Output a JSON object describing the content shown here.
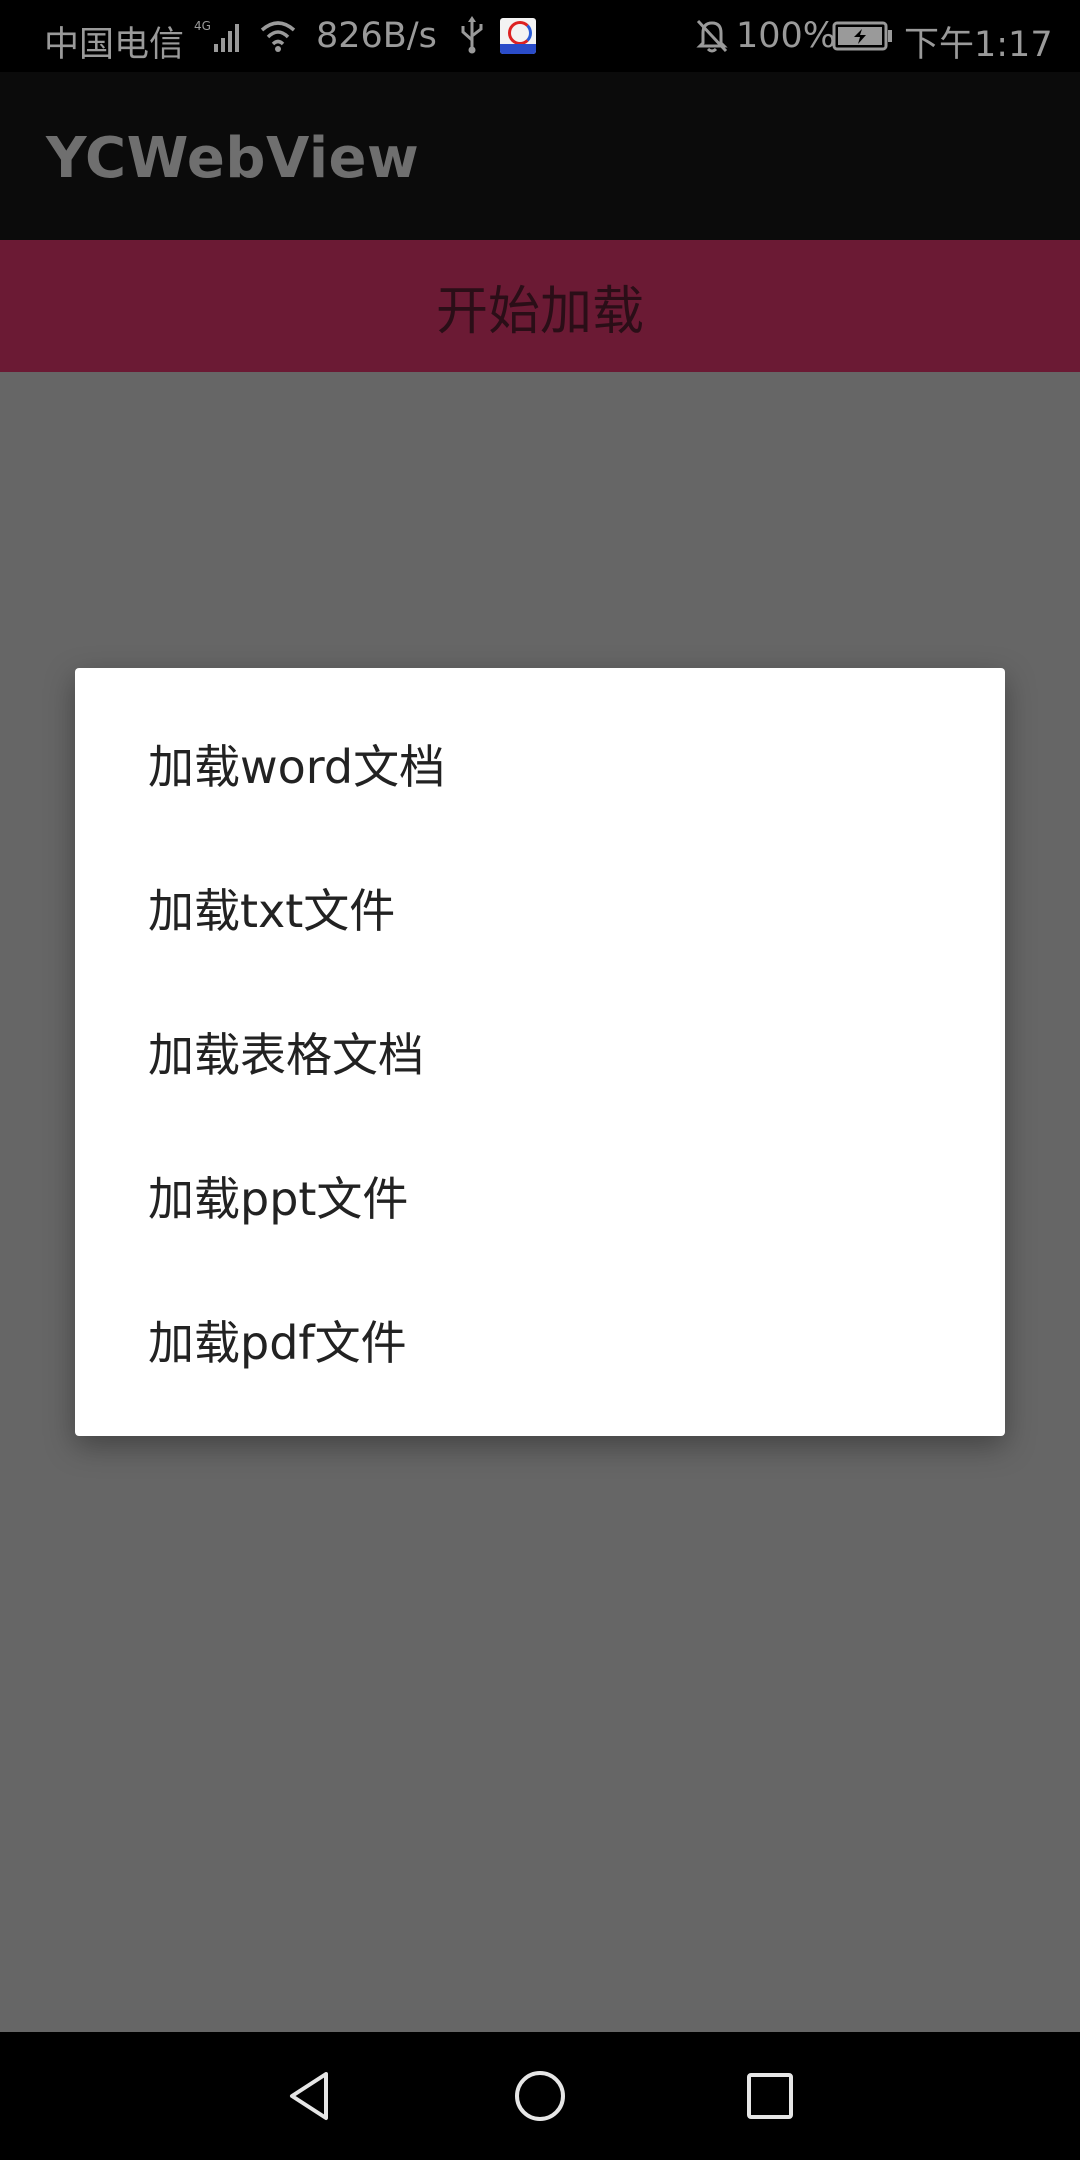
{
  "status_bar": {
    "carrier": "中国电信",
    "network": "4G",
    "speed": "826B/s",
    "battery_percent": "100%",
    "time": "下午1:17",
    "icons": [
      "signal-icon",
      "wifi-icon",
      "usb-icon",
      "app-notification-icon",
      "mute-bell-icon",
      "battery-charging-icon"
    ]
  },
  "app_bar": {
    "title": "YCWebView"
  },
  "main": {
    "start_button": "开始加载"
  },
  "dialog": {
    "items": [
      {
        "label": "加载word文档"
      },
      {
        "label": "加载txt文件"
      },
      {
        "label": "加载表格文档"
      },
      {
        "label": "加载ppt文件"
      },
      {
        "label": "加载pdf文件"
      }
    ]
  },
  "nav_bar": {
    "buttons": [
      "back-icon",
      "home-icon",
      "recents-icon"
    ]
  },
  "colors": {
    "accent": "#6b1a34",
    "scrim": "#666666",
    "dialog_bg": "#ffffff"
  }
}
